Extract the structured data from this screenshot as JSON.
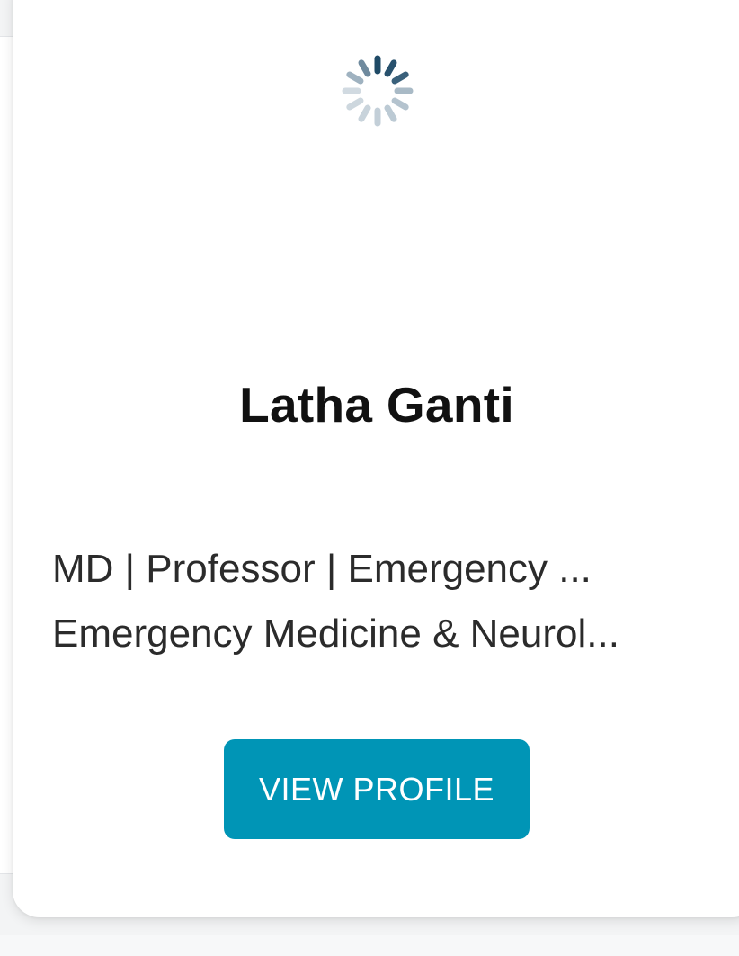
{
  "profile_card": {
    "name": "Latha Ganti",
    "subtitle_line1": "MD | Professor | Emergency ...",
    "subtitle_line2": "Emergency Medicine & Neurol...",
    "button_label": "VIEW PROFILE",
    "button_color": "#0095b6",
    "loading_icon": "spinner-icon"
  }
}
